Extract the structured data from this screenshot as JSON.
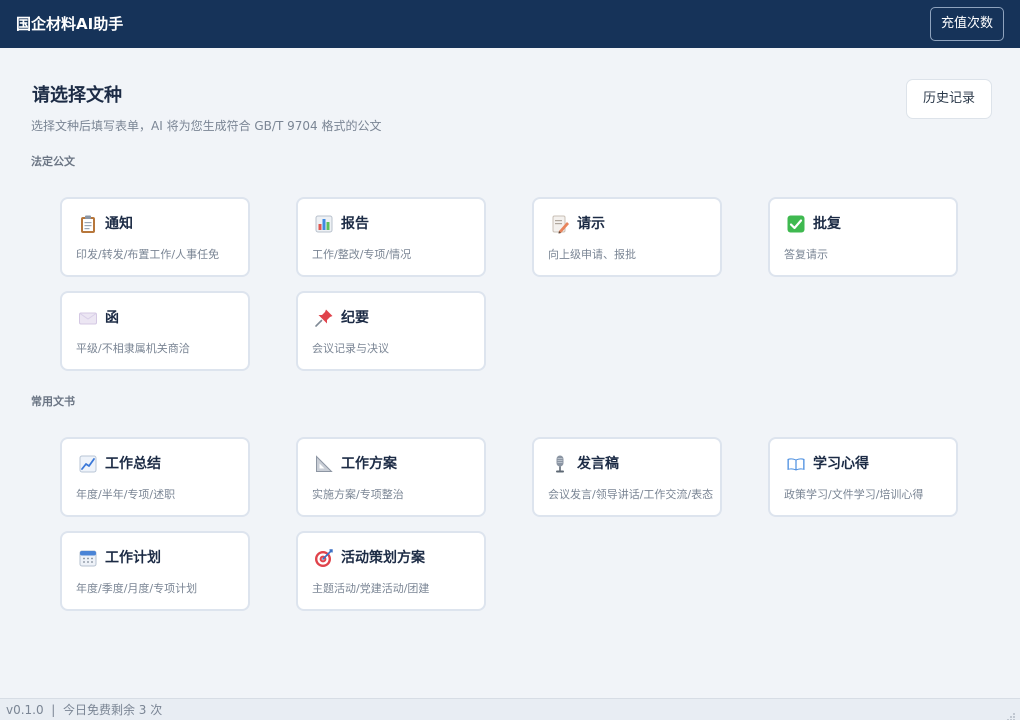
{
  "header": {
    "app_title": "国企材料AI助手",
    "recharge_label": "充值次数"
  },
  "main": {
    "title": "请选择文种",
    "subtitle": "选择文种后填写表单，AI 将为您生成符合 GB/T 9704 格式的公文",
    "history_label": "历史记录"
  },
  "sections": [
    {
      "title": "法定公文",
      "cards": [
        {
          "title": "通知",
          "desc": "印发/转发/布置工作/人事任免",
          "icon": "clipboard-icon"
        },
        {
          "title": "报告",
          "desc": "工作/整改/专项/情况",
          "icon": "bar-chart-icon"
        },
        {
          "title": "请示",
          "desc": "向上级申请、报批",
          "icon": "memo-icon"
        },
        {
          "title": "批复",
          "desc": "答复请示",
          "icon": "check-mark-icon"
        },
        {
          "title": "函",
          "desc": "平级/不相隶属机关商洽",
          "icon": "envelope-icon"
        },
        {
          "title": "纪要",
          "desc": "会议记录与决议",
          "icon": "pushpin-icon"
        }
      ]
    },
    {
      "title": "常用文书",
      "cards": [
        {
          "title": "工作总结",
          "desc": "年度/半年/专项/述职",
          "icon": "trend-chart-icon"
        },
        {
          "title": "工作方案",
          "desc": "实施方案/专项整治",
          "icon": "triangle-ruler-icon"
        },
        {
          "title": "发言稿",
          "desc": "会议发言/领导讲话/工作交流/表态",
          "icon": "microphone-icon"
        },
        {
          "title": "学习心得",
          "desc": "政策学习/文件学习/培训心得",
          "icon": "open-book-icon"
        },
        {
          "title": "工作计划",
          "desc": "年度/季度/月度/专项计划",
          "icon": "calendar-icon"
        },
        {
          "title": "活动策划方案",
          "desc": "主题活动/党建活动/团建",
          "icon": "target-icon"
        }
      ]
    }
  ],
  "footer": {
    "version": "v0.1.0",
    "separator": "|",
    "quota_text": "今日免费剩余 3 次"
  }
}
